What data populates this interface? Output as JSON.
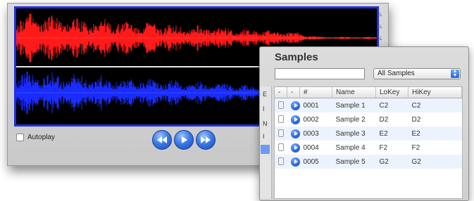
{
  "editor": {
    "wave_top_color": "#ff1a1a",
    "wave_bottom_color": "#1a2cff",
    "frame_color": "#1f2fe0",
    "side_marks": [
      "L",
      "L",
      "L"
    ],
    "autoplay_label": "Autoplay",
    "transport": {
      "rewind_icon": "rewind-icon",
      "play_icon": "play-icon",
      "forward_icon": "fast-forward-icon"
    }
  },
  "samples": {
    "title": "Samples",
    "search_placeholder": "",
    "filter_selected": "All Samples",
    "left_strip_letters": [
      "E",
      "I",
      "N",
      "I"
    ],
    "columns": [
      "-",
      "-",
      "#",
      "Name",
      "LoKey",
      "HiKey"
    ],
    "rows": [
      {
        "num": "0001",
        "name": "Sample 1",
        "lokey": "C2",
        "hikey": "C2"
      },
      {
        "num": "0002",
        "name": "Sample 2",
        "lokey": "D2",
        "hikey": "D2"
      },
      {
        "num": "0003",
        "name": "Sample 3",
        "lokey": "E2",
        "hikey": "E2"
      },
      {
        "num": "0004",
        "name": "Sample 4",
        "lokey": "F2",
        "hikey": "F2"
      },
      {
        "num": "0005",
        "name": "Sample 5",
        "lokey": "G2",
        "hikey": "G2"
      }
    ]
  }
}
